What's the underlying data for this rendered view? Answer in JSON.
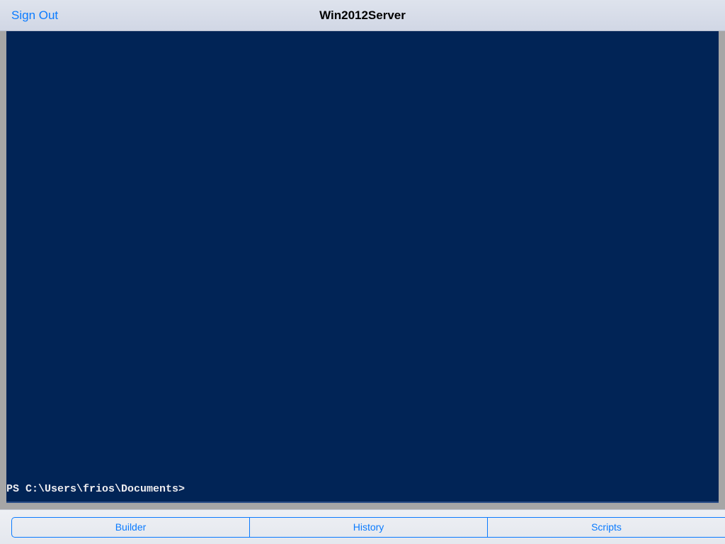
{
  "nav": {
    "sign_out": "Sign Out",
    "title": "Win2012Server"
  },
  "terminal": {
    "prompt": "PS C:\\Users\\frios\\Documents>"
  },
  "toolbar": {
    "segments": {
      "builder": "Builder",
      "history": "History",
      "scripts": "Scripts"
    }
  }
}
